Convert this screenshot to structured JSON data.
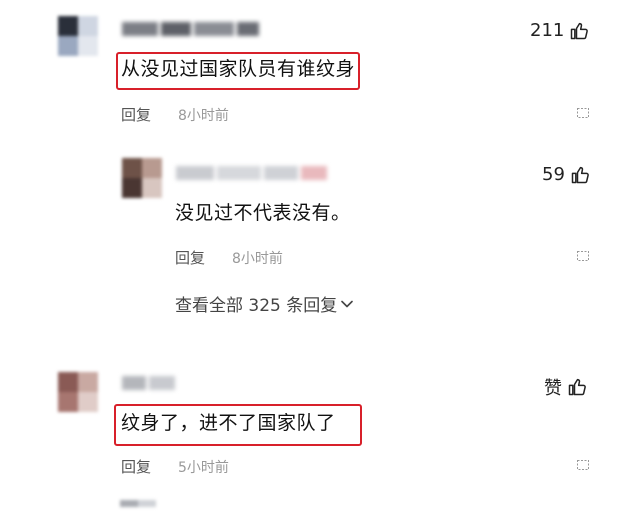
{
  "comments": [
    {
      "likes": "211",
      "text": "从没见过国家队员有谁纹身",
      "reply_label": "回复",
      "time": "8小时前",
      "avatar_colors": [
        "#2a2f3a",
        "#cfd6e2",
        "#9aa8c0",
        "#e3e7ee"
      ]
    },
    {
      "likes": "59",
      "text": "没见过不代表没有。",
      "reply_label": "回复",
      "time": "8小时前",
      "avatar_colors": [
        "#6e5248",
        "#b89a90",
        "#4a3632",
        "#d8c6c0"
      ],
      "view_all_label": "查看全部 325 条回复"
    },
    {
      "likes": "赞",
      "text": "纹身了，进不了国家队了",
      "reply_label": "回复",
      "time": "5小时前",
      "avatar_colors": [
        "#8a5a55",
        "#c9a9a2",
        "#a77670",
        "#e0ccc8"
      ]
    }
  ],
  "colors": {
    "highlight": "#d8202a",
    "meta_text": "#999999"
  }
}
